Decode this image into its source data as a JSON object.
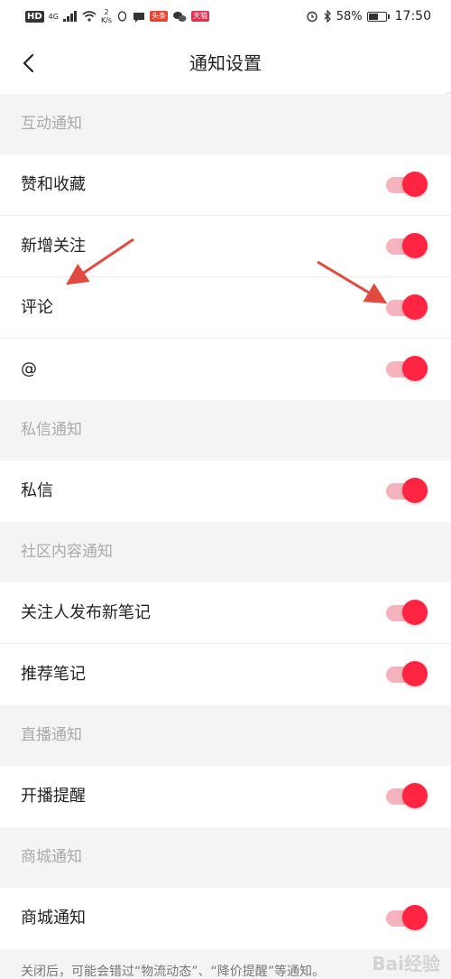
{
  "status_bar": {
    "hd": "HD",
    "network": "4G",
    "speed_value": "2",
    "speed_unit": "K/s",
    "badge_1": "头条",
    "badge_2": "天猫",
    "battery_percent": "58%",
    "battery_level": 0.58,
    "time": "17:50"
  },
  "nav": {
    "title": "通知设置"
  },
  "sections": [
    {
      "header": "互动通知",
      "items": [
        {
          "label": "赞和收藏",
          "enabled": true
        },
        {
          "label": "新增关注",
          "enabled": true
        },
        {
          "label": "评论",
          "enabled": true
        },
        {
          "label": "@",
          "enabled": true
        }
      ]
    },
    {
      "header": "私信通知",
      "items": [
        {
          "label": "私信",
          "enabled": true
        }
      ]
    },
    {
      "header": "社区内容通知",
      "items": [
        {
          "label": "关注人发布新笔记",
          "enabled": true
        },
        {
          "label": "推荐笔记",
          "enabled": true
        }
      ]
    },
    {
      "header": "直播通知",
      "items": [
        {
          "label": "开播提醒",
          "enabled": true
        }
      ]
    },
    {
      "header": "商城通知",
      "items": [
        {
          "label": "商城通知",
          "enabled": true
        }
      ]
    }
  ],
  "footer": {
    "note": "关闭后，可能会错过“物流动态”、“降价提醒”等通知。"
  },
  "watermark": "Bai经验",
  "colors": {
    "accent": "#ff2442",
    "track": "#f4b3bd",
    "arrow": "#e04a3f"
  }
}
